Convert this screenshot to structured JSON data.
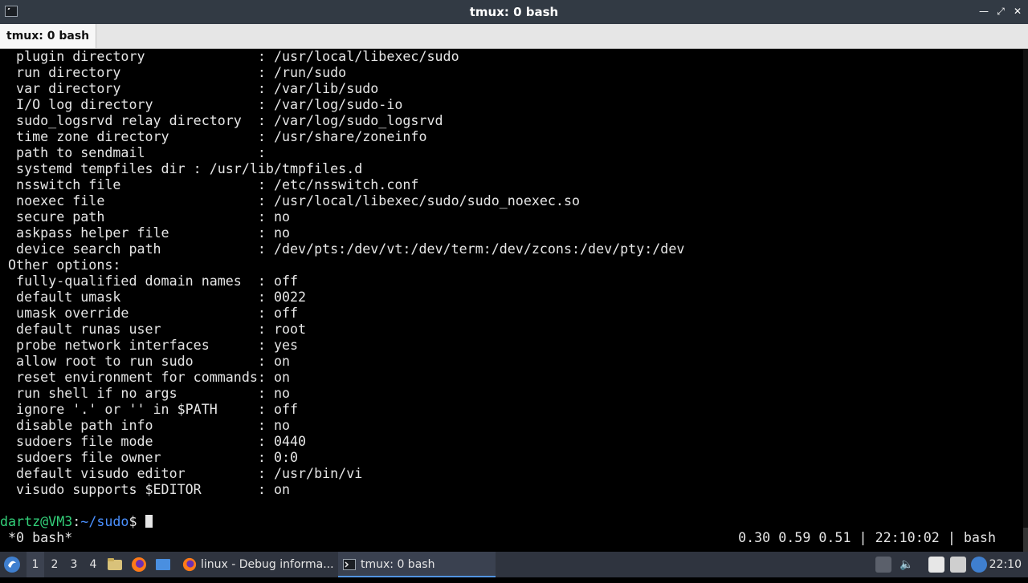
{
  "window": {
    "title": "tmux: 0 bash",
    "tab_label": "tmux: 0 bash"
  },
  "terminal": {
    "lines": [
      "  plugin directory              : /usr/local/libexec/sudo",
      "  run directory                 : /run/sudo",
      "  var directory                 : /var/lib/sudo",
      "  I/O log directory             : /var/log/sudo-io",
      "  sudo_logsrvd relay directory  : /var/log/sudo_logsrvd",
      "  time zone directory           : /usr/share/zoneinfo",
      "  path to sendmail              :",
      "  systemd tempfiles dir : /usr/lib/tmpfiles.d",
      "  nsswitch file                 : /etc/nsswitch.conf",
      "  noexec file                   : /usr/local/libexec/sudo/sudo_noexec.so",
      "  secure path                   : no",
      "  askpass helper file           : no",
      "  device search path            : /dev/pts:/dev/vt:/dev/term:/dev/zcons:/dev/pty:/dev",
      " Other options:",
      "  fully-qualified domain names  : off",
      "  default umask                 : 0022",
      "  umask override                : off",
      "  default runas user            : root",
      "  probe network interfaces      : yes",
      "  allow root to run sudo        : on",
      "  reset environment for commands: on",
      "  run shell if no args          : no",
      "  ignore '.' or '' in $PATH     : off",
      "  disable path info             : no",
      "  sudoers file mode             : 0440",
      "  sudoers file owner            : 0:0",
      "  default visudo editor         : /usr/bin/vi",
      "  visudo supports $EDITOR       : on",
      ""
    ],
    "prompt": {
      "user_host": "dartz@VM3",
      "sep": ":",
      "path": "~/sudo",
      "symbol": "$ "
    }
  },
  "tmux_status": {
    "left": " *0 bash*",
    "right": "0.30 0.59 0.51 | 22:10:02 | bash"
  },
  "taskbar": {
    "workspaces": [
      "1",
      "2",
      "3",
      "4"
    ],
    "tasks": [
      {
        "label": "linux - Debug informa...",
        "icon": "firefox-icon"
      },
      {
        "label": "tmux: 0 bash",
        "icon": "terminal-icon"
      }
    ],
    "clock": "22:10"
  },
  "colors": {
    "titlebar": "#323a44",
    "prompt_user": "#33d17a",
    "prompt_path": "#4a90ff",
    "taskbar": "#2f343f",
    "accent": "#5294e2"
  }
}
